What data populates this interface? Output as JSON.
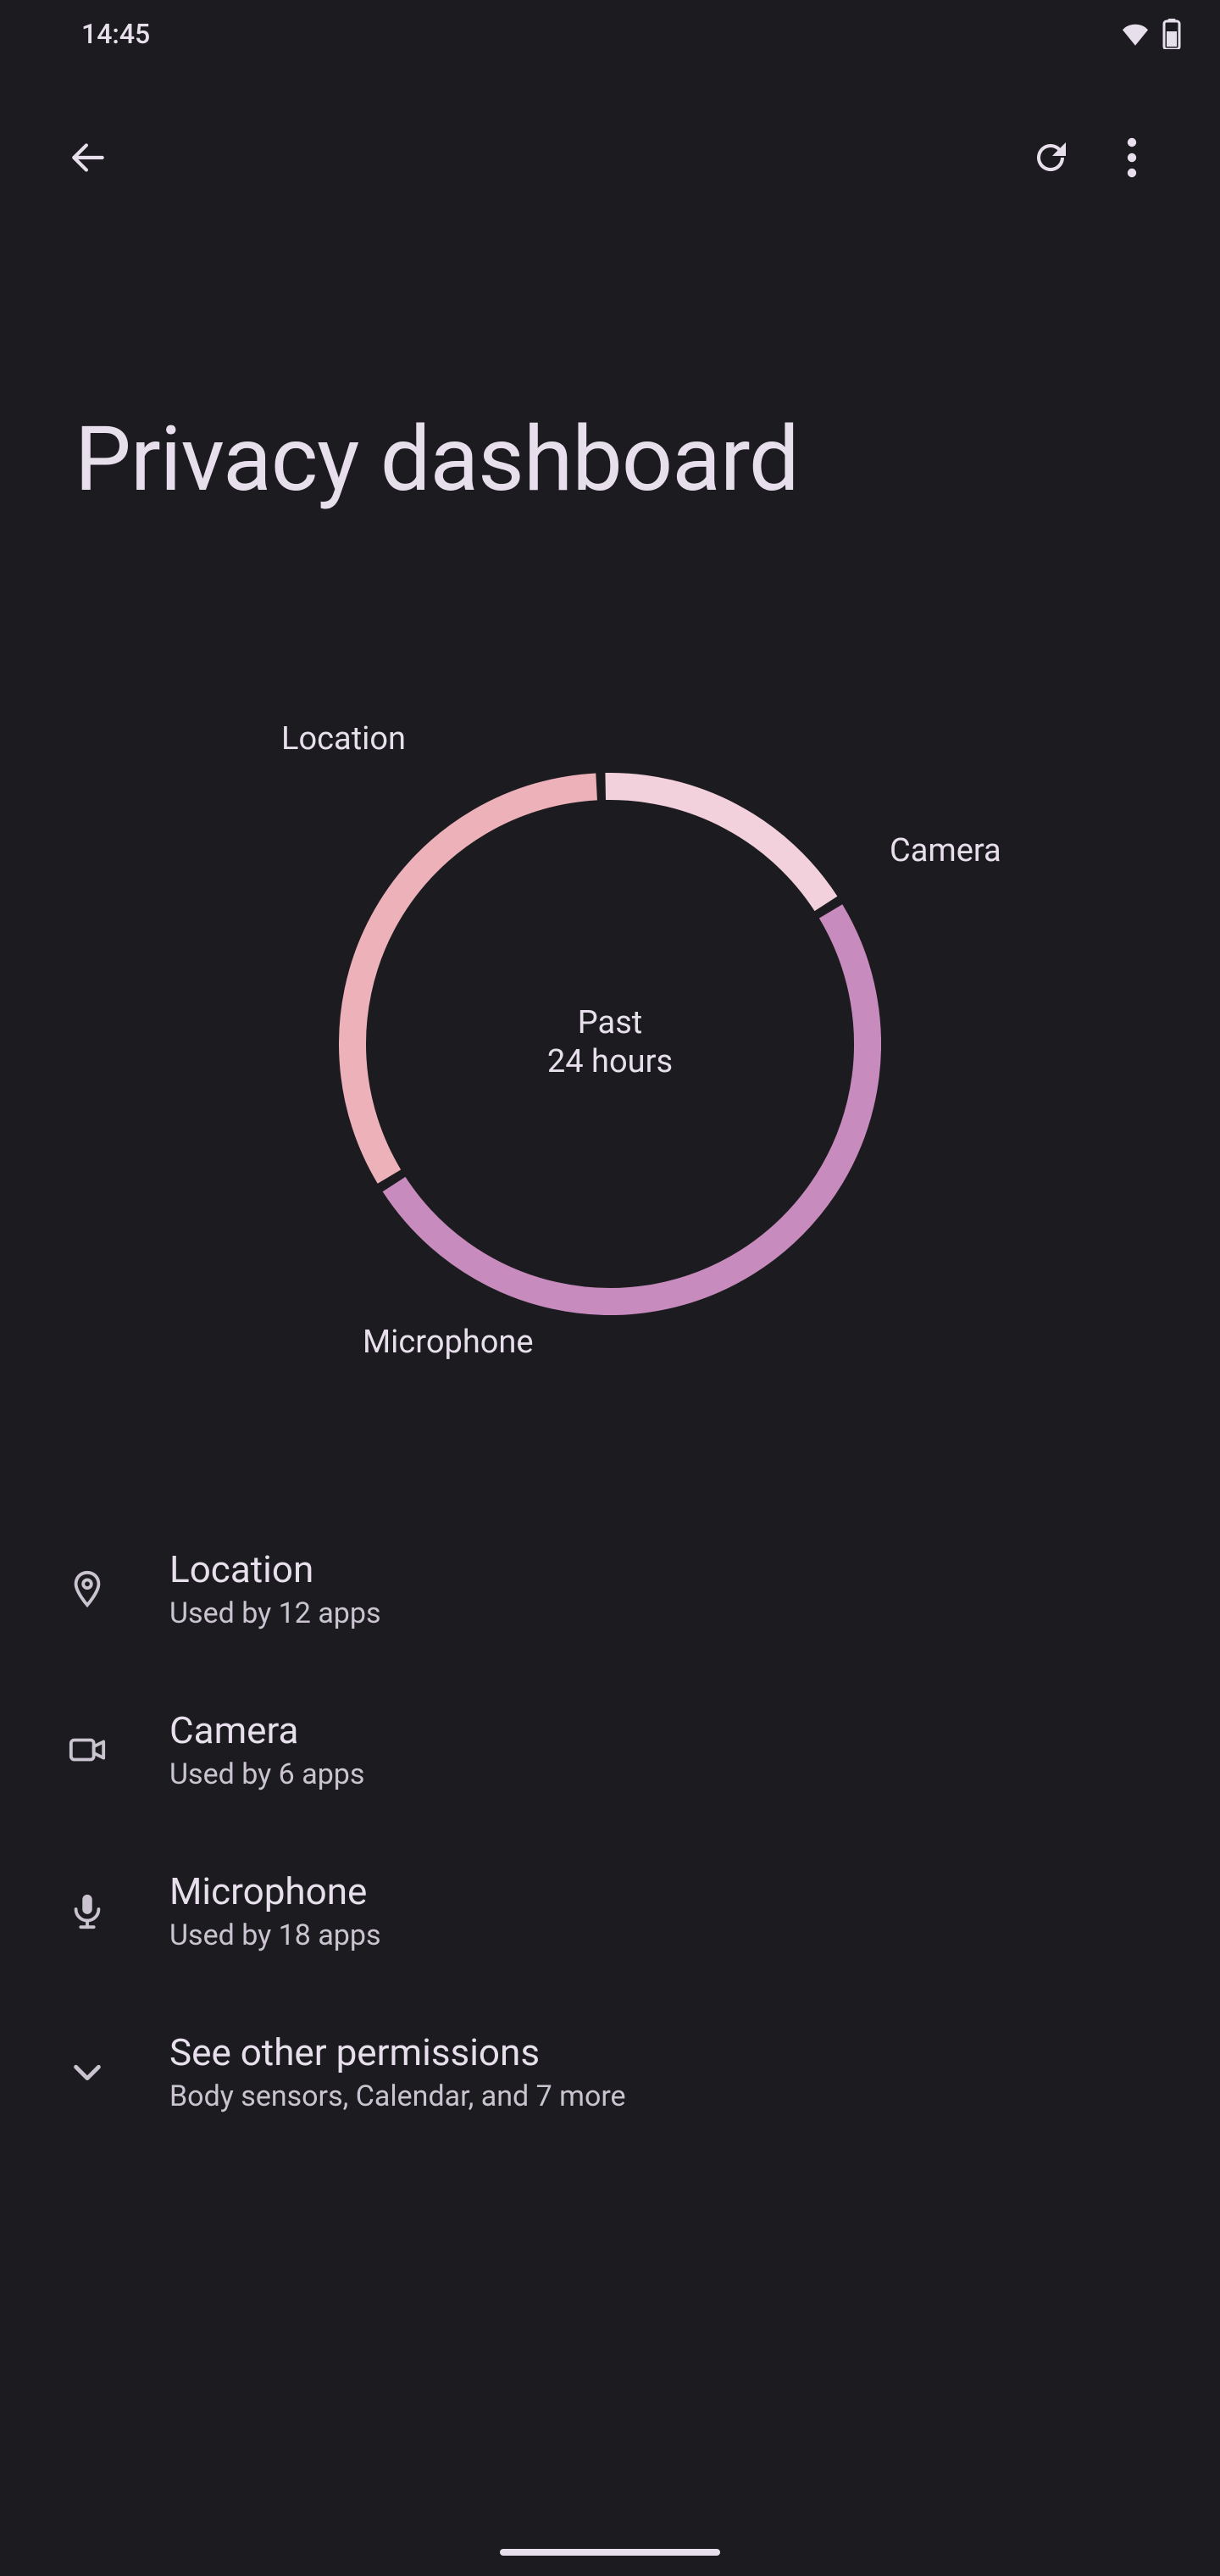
{
  "status": {
    "time": "14:45"
  },
  "header": {
    "title": "Privacy dashboard"
  },
  "chart": {
    "center_line1": "Past",
    "center_line2": "24 hours",
    "label_location": "Location",
    "label_camera": "Camera",
    "label_microphone": "Microphone"
  },
  "chart_data": {
    "type": "pie",
    "title": "Past 24 hours",
    "categories": [
      "Location",
      "Camera",
      "Microphone"
    ],
    "values": [
      12,
      6,
      18
    ],
    "colors": [
      "#edb1ba",
      "#f3d1dc",
      "#c88bbd"
    ],
    "annotations": [
      "Location",
      "Camera",
      "Microphone"
    ]
  },
  "list": {
    "items": [
      {
        "title": "Location",
        "sub": "Used by 12 apps",
        "icon": "location"
      },
      {
        "title": "Camera",
        "sub": "Used by 6 apps",
        "icon": "camera"
      },
      {
        "title": "Microphone",
        "sub": "Used by 18 apps",
        "icon": "microphone"
      },
      {
        "title": "See other permissions",
        "sub": "Body sensors, Calendar, and 7 more",
        "icon": "expand"
      }
    ]
  }
}
